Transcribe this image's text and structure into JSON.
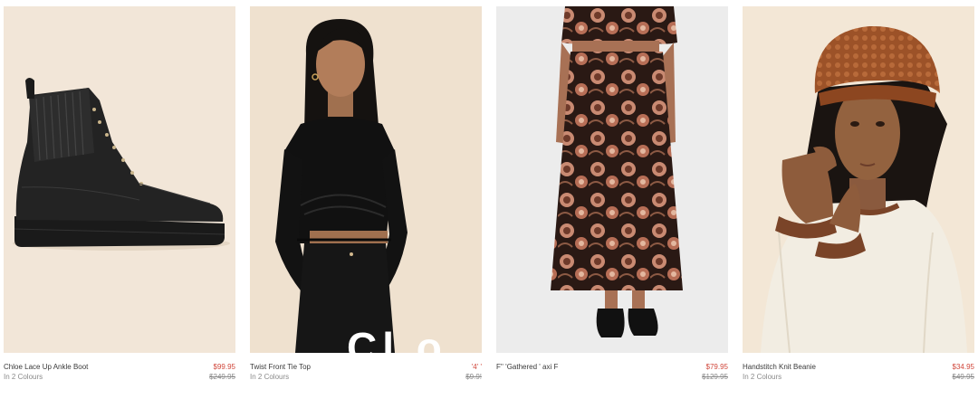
{
  "colors": {
    "price_sale": "#d0463a",
    "muted": "#8a8a8a",
    "text": "#3a3a3a"
  },
  "products": [
    {
      "name": "Chloe Lace Up Ankle Boot",
      "colours": "In 2 Colours",
      "price": "$99.95",
      "was": "$249.95"
    },
    {
      "name": "Twist Front Tie Top",
      "colours": "In 2 Colours",
      "price": "'4' '",
      "was": "$9.9!"
    },
    {
      "name": "F'' 'Gathered ' axi F",
      "colours": "",
      "price": "$79.95",
      "was": "$129.95"
    },
    {
      "name": "Handstitch Knit Beanie",
      "colours": "In 2 Colours",
      "price": "$34.95",
      "was": "$49.95"
    }
  ],
  "overlay": {
    "text": "Cl  o"
  }
}
